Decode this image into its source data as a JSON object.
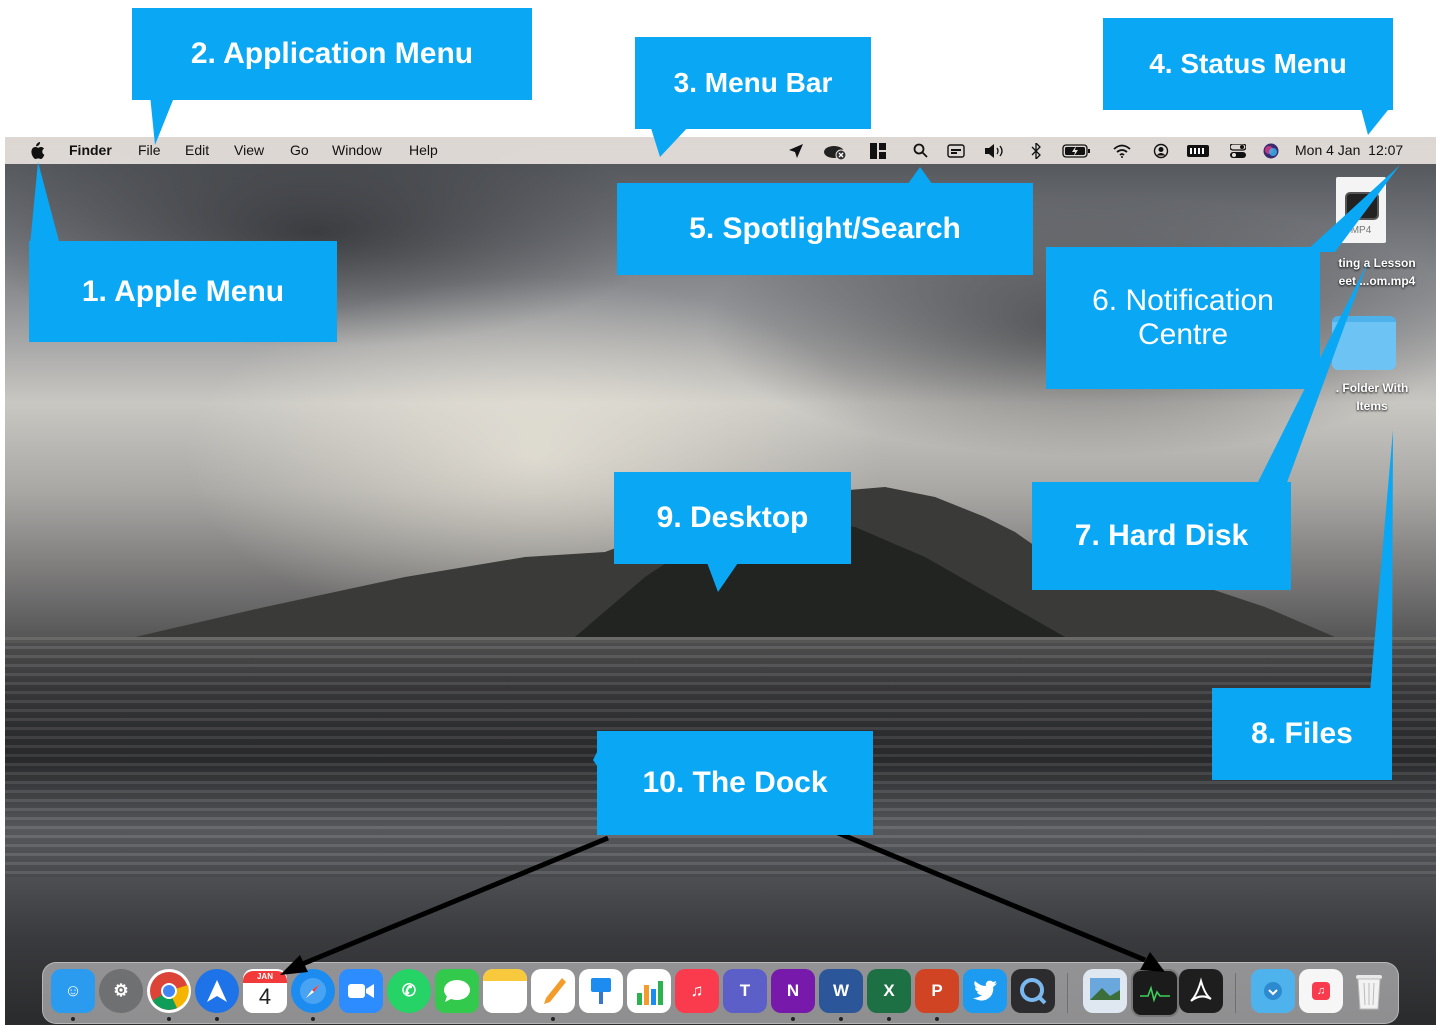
{
  "menubar": {
    "apple_icon": "apple-logo",
    "app_name": "Finder",
    "menus": [
      "File",
      "Edit",
      "View",
      "Go",
      "Window",
      "Help"
    ],
    "datetime": "Mon 4 Jan  12:07",
    "status_icons": [
      "location-arrow-icon",
      "creative-cloud-icon",
      "layout-icon",
      "search-icon",
      "input-icon",
      "volume-icon",
      "bluetooth-icon",
      "battery-icon",
      "wifi-icon",
      "user-icon",
      "battery-meter-icon",
      "control-centre-icon",
      "siri-icon"
    ]
  },
  "desktop": {
    "files": [
      {
        "badge": "MP4",
        "label_line1": "ting a Lesson",
        "label_line2": "eet ...om.mp4"
      },
      {
        "label_line1": ". Folder With",
        "label_line2": "Items"
      }
    ]
  },
  "callouts": {
    "apple_menu": "1. Apple Menu",
    "application_menu": "2. Application Menu",
    "menu_bar": "3. Menu Bar",
    "status_menu": "4. Status Menu",
    "spotlight": "5. Spotlight/Search",
    "notification_line1": "6. Notification",
    "notification_line2": "Centre",
    "hard_disk": "7. Hard Disk",
    "files": "8. Files",
    "desktop": "9. Desktop",
    "dock": "10. The Dock"
  },
  "dock": {
    "calendar_month": "JAN",
    "calendar_day": "4",
    "apps": [
      "finder",
      "system-preferences",
      "chrome",
      "spark",
      "calendar",
      "safari",
      "zoom",
      "whatsapp",
      "messages",
      "notes",
      "pages",
      "keynote",
      "numbers",
      "music",
      "teams",
      "onenote",
      "word",
      "excel",
      "powerpoint",
      "twitter",
      "quicktime",
      "preview",
      "activity-monitor",
      "acrobat",
      "downloads",
      "m4a-file",
      "trash"
    ],
    "colors": {
      "finder": "#2b9bf0",
      "chrome": "#ffffff",
      "spark": "#1e73e8",
      "safari": "#1c8cf0",
      "zoom": "#2d8cff",
      "whatsapp": "#25d366",
      "messages": "#33c94c",
      "music": "#fa3b4d",
      "teams": "#5b5fc7",
      "onenote": "#7719aa",
      "word": "#2b579a",
      "excel": "#1d7044",
      "powerpoint": "#d04423",
      "twitter": "#1d9bf0",
      "acrobat": "#1e1e1e"
    }
  }
}
